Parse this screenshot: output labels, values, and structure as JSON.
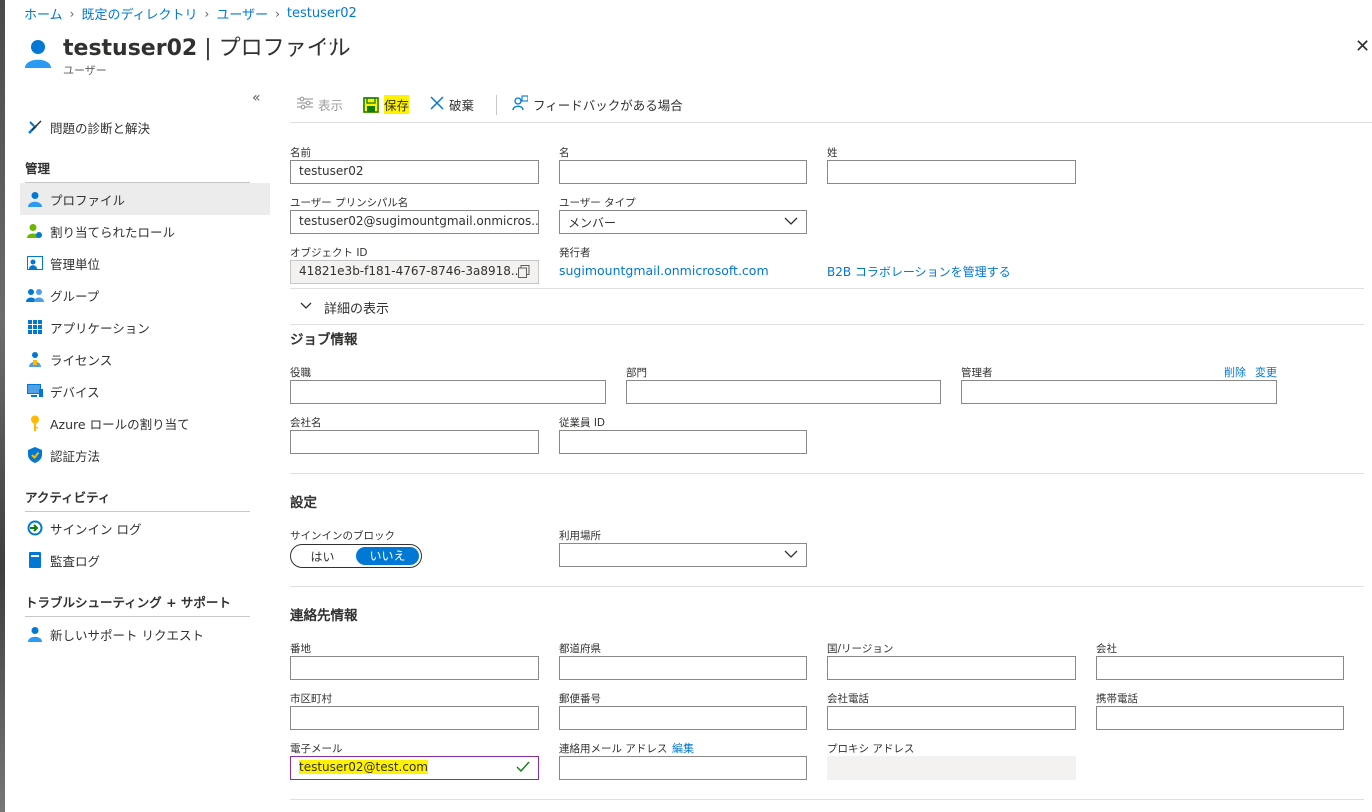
{
  "breadcrumb": [
    "ホーム",
    "既定のディレクトリ",
    "ユーザー",
    "testuser02"
  ],
  "header": {
    "title_user": "testuser02",
    "title_sep": "|",
    "title_page": "プロファイル",
    "subtitle": "ユーザー",
    "more": "···",
    "close": "✕"
  },
  "sidebar": {
    "collapse": "«",
    "top_item": "問題の診断と解決",
    "manage_heading": "管理",
    "manage_items": [
      "プロファイル",
      "割り当てられたロール",
      "管理単位",
      "グループ",
      "アプリケーション",
      "ライセンス",
      "デバイス",
      "Azure ロールの割り当て",
      "認証方法"
    ],
    "activity_heading": "アクティビティ",
    "activity_items": [
      "サインイン ログ",
      "監査ログ"
    ],
    "support_heading": "トラブルシューティング + サポート",
    "support_items": [
      "新しいサポート リクエスト"
    ]
  },
  "toolbar": {
    "view": "表示",
    "save": "保存",
    "discard": "破棄",
    "feedback": "フィードバックがある場合"
  },
  "identity": {
    "name_label": "名前",
    "name_value": "testuser02",
    "first_label": "名",
    "first_value": "",
    "last_label": "姓",
    "last_value": "",
    "upn_label": "ユーザー プリンシパル名",
    "upn_value": "testuser02@sugimountgmail.onmicros...",
    "type_label": "ユーザー タイプ",
    "type_value": "メンバー",
    "objid_label": "オブジェクト ID",
    "objid_value": "41821e3b-f181-4767-8746-3a8918...",
    "issuer_label": "発行者",
    "issuer_value": "sugimountgmail.onmicrosoft.com",
    "b2b_link": "B2B コラボレーションを管理する",
    "details_toggle": "詳細の表示"
  },
  "job": {
    "heading": "ジョブ情報",
    "title_label": "役職",
    "dept_label": "部門",
    "manager_label": "管理者",
    "manager_delete": "削除",
    "manager_change": "変更",
    "company_label": "会社名",
    "empid_label": "従業員 ID"
  },
  "settings": {
    "heading": "設定",
    "block_label": "サインインのブロック",
    "block_yes": "はい",
    "block_no": "いいえ",
    "location_label": "利用場所",
    "location_value": ""
  },
  "contact": {
    "heading": "連絡先情報",
    "street_label": "番地",
    "state_label": "都道府県",
    "country_label": "国/リージョン",
    "office_label": "会社",
    "city_label": "市区町村",
    "zip_label": "郵便番号",
    "phone_label": "会社電話",
    "mobile_label": "携帯電話",
    "email_label": "電子メール",
    "email_value": "testuser02@test.com",
    "alt_email_label": "連絡用メール アドレス",
    "alt_email_edit": "編集",
    "proxy_label": "プロキシ アドレス"
  },
  "colors": {
    "accent": "#0078d4",
    "highlight": "#fff200",
    "email_border": "#8a2da5",
    "valid_check": "#107c10"
  }
}
